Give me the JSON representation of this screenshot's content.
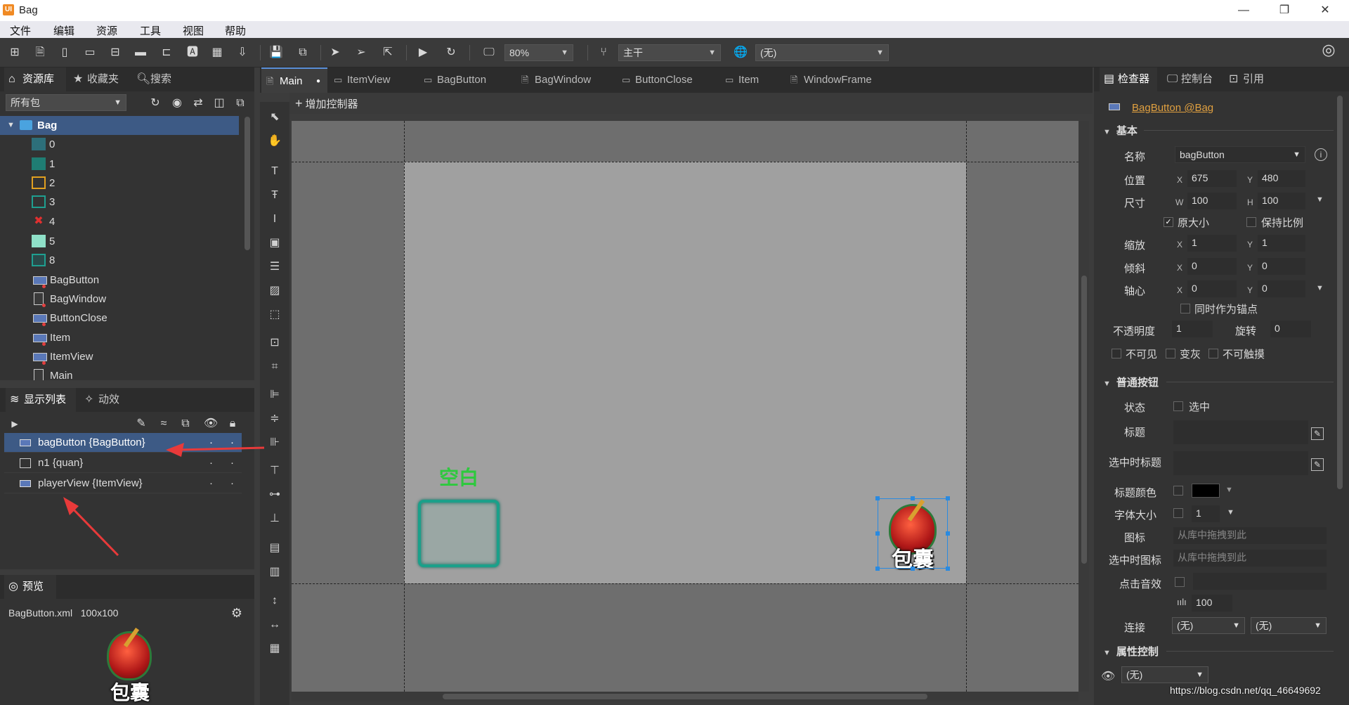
{
  "window": {
    "title": "Bag",
    "app_icon_text": "UI"
  },
  "menu": [
    "文件",
    "编辑",
    "资源",
    "工具",
    "视图",
    "帮助"
  ],
  "toolbar": {
    "zoom": "80%",
    "branch": "主干",
    "language": "(无)"
  },
  "library": {
    "tabs": [
      "资源库",
      "收藏夹",
      "搜索"
    ],
    "filter": "所有包",
    "root": "Bag",
    "items": [
      "0",
      "1",
      "2",
      "3",
      "4",
      "5",
      "8",
      "BagButton",
      "BagWindow",
      "ButtonClose",
      "Item",
      "ItemView",
      "Main"
    ]
  },
  "display_list": {
    "tabs": [
      "显示列表",
      "动效"
    ],
    "rows": [
      "bagButton {BagButton}",
      "n1 {quan}",
      "playerView {ItemView}"
    ]
  },
  "preview": {
    "tab": "预览",
    "file_info": "BagButton.xml   100x100",
    "image_text": "包囊"
  },
  "doc_tabs": [
    "Main",
    "ItemView",
    "BagButton",
    "BagWindow",
    "ButtonClose",
    "Item",
    "WindowFrame"
  ],
  "canvas": {
    "add_controller": "增加控制器",
    "empty_label": "空白",
    "bag_text": "包囊"
  },
  "inspector": {
    "tabs": [
      "检查器",
      "控制台",
      "引用"
    ],
    "header_link": "BagButton @Bag",
    "basic_section": "基本",
    "name_label": "名称",
    "name_value": "bagButton",
    "position_label": "位置",
    "pos_x": "675",
    "pos_y": "480",
    "size_label": "尺寸",
    "size_w": "100",
    "size_h": "100",
    "original_size": "原大小",
    "keep_ratio": "保持比例",
    "scale_label": "缩放",
    "scale_x": "1",
    "scale_y": "1",
    "skew_label": "倾斜",
    "skew_x": "0",
    "skew_y": "0",
    "pivot_label": "轴心",
    "pivot_x": "0",
    "pivot_y": "0",
    "as_anchor": "同时作为锚点",
    "opacity_label": "不透明度",
    "opacity_value": "1",
    "rotation_label": "旋转",
    "rotation_value": "0",
    "invisible": "不可见",
    "grayed": "变灰",
    "untouchable": "不可触摸",
    "button_section": "普通按钮",
    "state_label": "状态",
    "selected": "选中",
    "title_label": "标题",
    "selected_title_label": "选中时标题",
    "title_color_label": "标题颜色",
    "title_color": "#000000",
    "font_size_label": "字体大小",
    "font_size_value": "1",
    "icon_label": "图标",
    "icon_placeholder": "从库中拖拽到此",
    "selected_icon_label": "选中时图标",
    "selected_icon_placeholder": "从库中拖拽到此",
    "click_sound_label": "点击音效",
    "volume": "100",
    "link_label": "连接",
    "link_a": "(无)",
    "link_b": "(无)",
    "prop_control_section": "属性控制",
    "prop_control_value": "(无)"
  },
  "watermark": "https://blog.csdn.net/qq_46649692"
}
